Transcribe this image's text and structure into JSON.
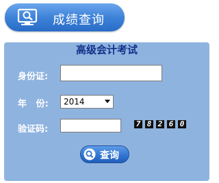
{
  "header": {
    "title": "成绩查询",
    "icon": "monitor-search-icon"
  },
  "panel": {
    "title": "高级会计考试",
    "id_label": "身份证:",
    "id_value": "",
    "year_label": "年   份:",
    "year_value": "2014",
    "captcha_label": "验证码:",
    "captcha_value": "",
    "captcha_digits": [
      "7",
      "8",
      "2",
      "6",
      "0"
    ],
    "query_label": "查询",
    "query_icon": "magnifier-icon"
  },
  "colors": {
    "panel_bg": "#8fb3df",
    "title_color": "#12318a",
    "button_blue": "#2f72d0"
  }
}
